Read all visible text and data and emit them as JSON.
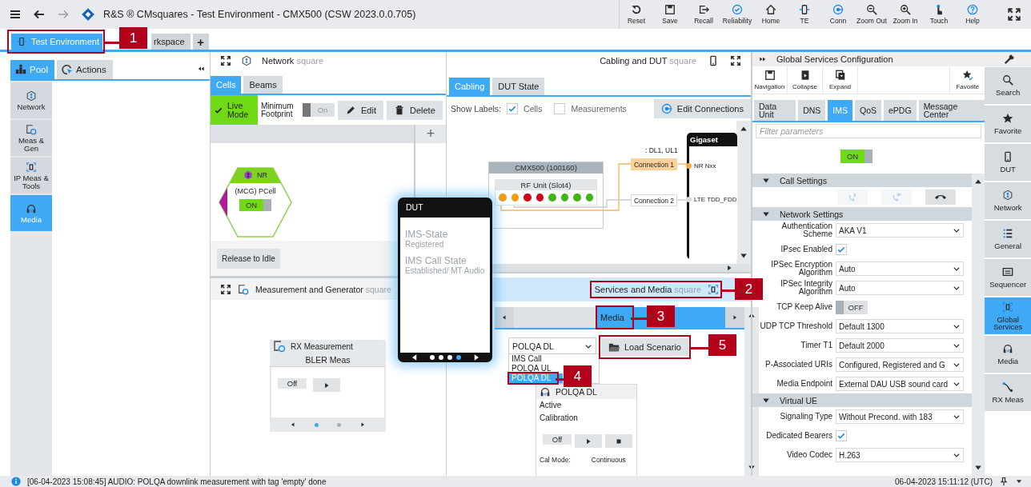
{
  "app_bar": {
    "title": "R&S ® CMsquares - Test Environment - CMX500 (CSW 2023.0.0.705)",
    "toolbar": [
      {
        "label": "Reset",
        "kind": "reset"
      },
      {
        "label": "Save",
        "kind": "save"
      },
      {
        "label": "Recall",
        "kind": "recall"
      },
      {
        "label": "Reliability",
        "kind": "reliability"
      },
      {
        "label": "Home",
        "kind": "home"
      },
      {
        "label": "TE",
        "kind": "te"
      },
      {
        "label": "Conn",
        "kind": "conn"
      },
      {
        "label": "Zoom Out",
        "kind": "zoomout"
      },
      {
        "label": "Zoom In",
        "kind": "zoomin"
      },
      {
        "label": "Touch",
        "kind": "touch"
      },
      {
        "label": "Help",
        "kind": "help"
      }
    ]
  },
  "workspace_tabs": [
    {
      "label": "Test Environment",
      "selected": true,
      "callout": "1"
    },
    {
      "label": "rkspace",
      "selected": false
    }
  ],
  "add_tab": "+",
  "pool": {
    "tabs": [
      {
        "label": "Pool",
        "kind": "pool",
        "selected": true
      },
      {
        "label": "Actions",
        "kind": "actions",
        "selected": false
      }
    ],
    "items": [
      {
        "label": "Network",
        "kind": "network",
        "selected": false
      },
      {
        "label": "Meas & Gen",
        "kind": "meas",
        "selected": false
      },
      {
        "label": "IP Meas & Tools",
        "kind": "ip",
        "selected": false
      },
      {
        "label": "Media",
        "kind": "media",
        "selected": true
      }
    ]
  },
  "network_square": {
    "title": "Network",
    "suffix": "square",
    "tabs": [
      {
        "label": "Cells",
        "selected": true
      },
      {
        "label": "Beams",
        "selected": false
      }
    ],
    "live_mode": {
      "label": "Live Mode",
      "on": true
    },
    "minimum_footprint": {
      "label": "Minimum Footprint",
      "toggle": "On",
      "on": false
    },
    "edit_button": "Edit",
    "delete_button": "Delete",
    "add_button": "+",
    "cell": {
      "rat": "NR",
      "name": "(MCG) PCell",
      "toggle": "ON",
      "on": true
    },
    "release_button": "Release to Idle"
  },
  "meas_square": {
    "title": "Measurement and Generator",
    "suffix": "square",
    "card": {
      "title": "RX Measurement",
      "subtitle": "BLER Meas",
      "toggle": "Off",
      "page_dots": [
        {
          "selected": true
        },
        {
          "selected": false
        }
      ]
    }
  },
  "cabling_square": {
    "title": "Cabling and DUT",
    "suffix": "square",
    "tabs": [
      {
        "label": "Cabling",
        "selected": true
      },
      {
        "label": "DUT State",
        "selected": false
      }
    ],
    "show_labels": "Show Labels:",
    "label_options": [
      {
        "label": "Cells",
        "checked": true
      },
      {
        "label": "Measurements",
        "checked": false
      }
    ],
    "edit_button": "Edit Connections",
    "instrument": {
      "name": "CMX500 (100160)",
      "unit": "RF Unit (Slot4)",
      "ports": [
        {
          "color": "#f39c12"
        },
        {
          "color": "#f39c12"
        },
        {
          "color": "#d0021b"
        },
        {
          "color": "#d0021b"
        },
        {
          "color": "#3fb618"
        },
        {
          "color": "#3fb618"
        },
        {
          "color": "#3fb618"
        },
        {
          "color": "#3fb618"
        }
      ]
    },
    "connection_note": ": DL1, UL1",
    "connections": [
      {
        "label": "Connection 1",
        "active": true,
        "target": "NR Nxx"
      },
      {
        "label": "Connection 2",
        "active": false,
        "target": "LTE TDD_FDD"
      }
    ],
    "dut": "Gigaset"
  },
  "dut_popup": {
    "title": "DUT",
    "fields": [
      {
        "label": "IMS-State",
        "value": "Registered"
      },
      {
        "label": "IMS Call State",
        "value": "Established/ MT Audio"
      }
    ],
    "page_dots": [
      {
        "selected": false
      },
      {
        "selected": false
      },
      {
        "selected": false
      },
      {
        "selected": true
      }
    ]
  },
  "services_square": {
    "title": "Services and Media",
    "suffix": "square",
    "callout": "2",
    "tabs": [
      {
        "label": "Media",
        "selected": true,
        "callout": "3"
      }
    ],
    "scenario_select": {
      "value": "POLQA DL",
      "expanded": true,
      "options": [
        {
          "label": "IMS Call",
          "selected": false
        },
        {
          "label": "POLQA UL",
          "selected": false
        },
        {
          "label": "POLQA DL",
          "selected": true,
          "callout": "4"
        }
      ]
    },
    "load_button": {
      "label": "Load Scenario",
      "callout": "5"
    },
    "card": {
      "title": "POLQA DL",
      "lines": [
        "Active",
        "Calibration"
      ],
      "toggle": "Off",
      "cal_mode_label": "Cal Mode:",
      "cal_mode": "Continuous"
    }
  },
  "global_services": {
    "title": "Global Services Configuration",
    "toolbar": [
      {
        "label": "Navigation",
        "kind": "navigation"
      },
      {
        "label": "Collapse",
        "kind": "collapse"
      },
      {
        "label": "Expand",
        "kind": "expand"
      },
      {
        "label": "Favorite",
        "kind": "favorite"
      }
    ],
    "tabs": [
      {
        "label": "Data Unit",
        "selected": false
      },
      {
        "label": "DNS",
        "selected": false
      },
      {
        "label": "IMS",
        "selected": true
      },
      {
        "label": "QoS",
        "selected": false
      },
      {
        "label": "ePDG",
        "selected": false
      },
      {
        "label": "Message Center",
        "selected": false
      }
    ],
    "filter": {
      "placeholder": "Filter parameters"
    },
    "master_toggle": {
      "label": "ON",
      "on": true
    },
    "sections": [
      {
        "title": "Call Settings",
        "expanded": true,
        "kind": "calls",
        "call_buttons": [
          {
            "kind": "voice",
            "disabled": true
          },
          {
            "kind": "video",
            "disabled": true
          },
          {
            "kind": "hangup",
            "disabled": false
          }
        ]
      },
      {
        "title": "Network Settings",
        "expanded": true,
        "kind": "form",
        "rows": [
          {
            "label": "Authentication Scheme",
            "kind": "select",
            "value": "AKA V1"
          },
          {
            "label": "IPsec Enabled",
            "kind": "check",
            "checked": true
          },
          {
            "label": "IPSec Encryption Algorithm",
            "kind": "select",
            "value": "Auto"
          },
          {
            "label": "IPSec Integrity Algorithm",
            "kind": "select",
            "value": "Auto"
          },
          {
            "label": "TCP Keep Alive",
            "kind": "toggle",
            "value": "OFF",
            "on": false
          },
          {
            "label": "UDP TCP Threshold",
            "kind": "select",
            "value": "Default 1300"
          },
          {
            "label": "Timer T1",
            "kind": "select",
            "value": "Default 2000"
          },
          {
            "label": "P-Associated URIs",
            "kind": "select",
            "value": "Configured, Registered and G"
          },
          {
            "label": "Media Endpoint",
            "kind": "select",
            "value": "External DAU USB sound card"
          }
        ]
      },
      {
        "title": "Virtual UE",
        "expanded": true,
        "kind": "form",
        "rows": [
          {
            "label": "Signaling Type",
            "kind": "select",
            "value": "Without Precond. with 183"
          },
          {
            "label": "Dedicated Bearers",
            "kind": "check",
            "checked": true
          },
          {
            "label": "Video Codec",
            "kind": "select",
            "value": "H.263"
          }
        ]
      }
    ]
  },
  "side_nav": [
    {
      "label": "Search",
      "kind": "search",
      "selected": false
    },
    {
      "label": "Favorite",
      "kind": "star",
      "selected": false
    },
    {
      "label": "DUT",
      "kind": "phone",
      "selected": false
    },
    {
      "label": "Network",
      "kind": "network",
      "selected": false
    },
    {
      "label": "General",
      "kind": "general",
      "selected": false
    },
    {
      "label": "Sequencer",
      "kind": "sequencer",
      "selected": false
    },
    {
      "label": "Global Services",
      "kind": "ip",
      "selected": true
    },
    {
      "label": "Media",
      "kind": "media",
      "selected": false
    },
    {
      "label": "RX Meas",
      "kind": "rx",
      "selected": false
    }
  ],
  "status_bar": {
    "message": "[06-04-2023 15:08:45] AUDIO: POLQA downlink measurement with tag 'empty' done",
    "time": "06-04-2023 15:11:12 (UTC)"
  }
}
